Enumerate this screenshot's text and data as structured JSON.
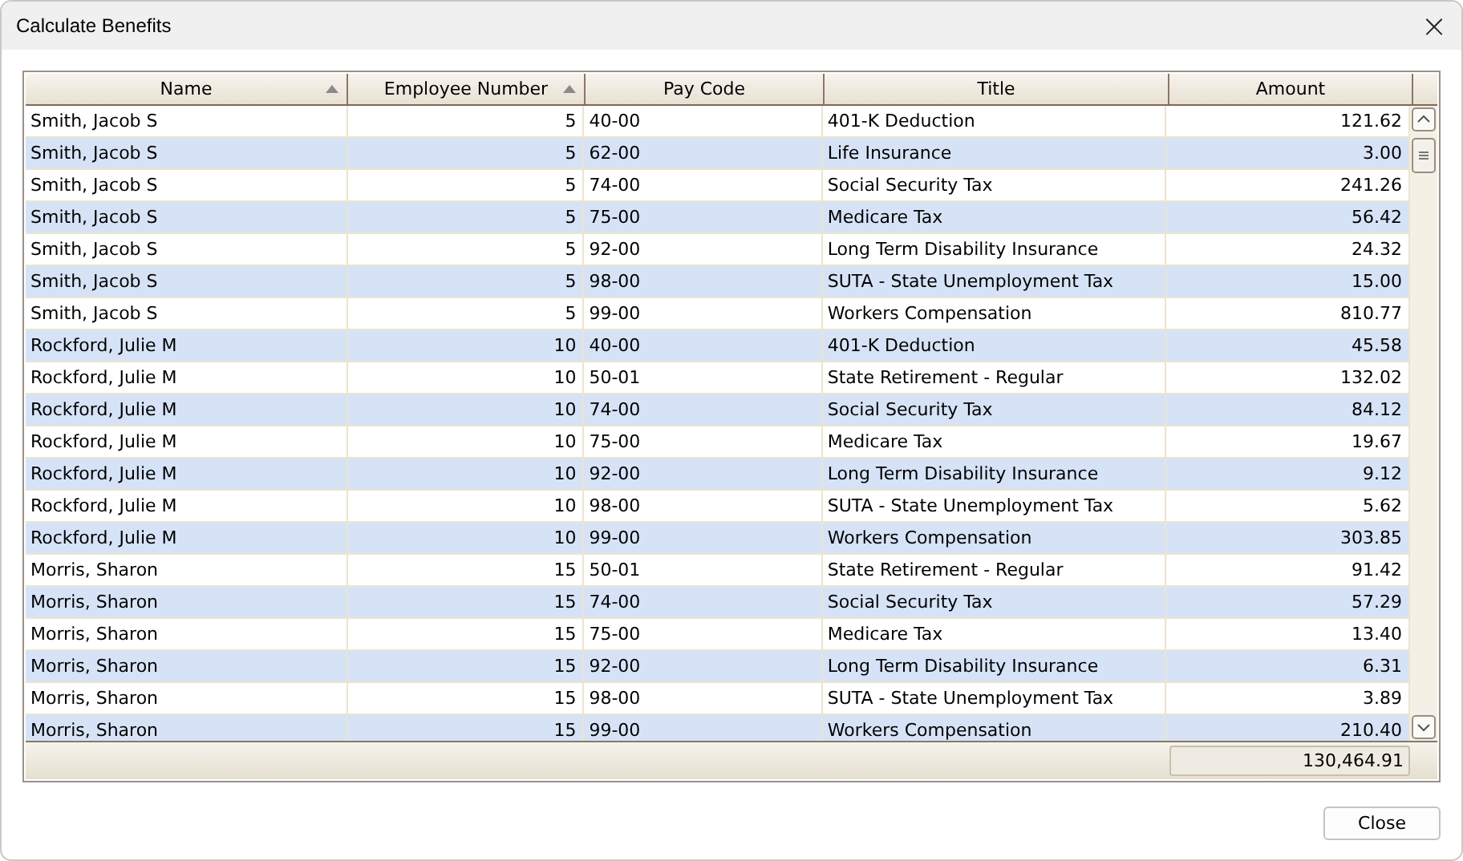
{
  "window": {
    "title": "Calculate Benefits",
    "close": "×"
  },
  "table": {
    "columns": [
      {
        "label": "Name",
        "sorted": true
      },
      {
        "label": "Employee Number",
        "sorted": true
      },
      {
        "label": "Pay Code",
        "sorted": false
      },
      {
        "label": "Title",
        "sorted": false
      },
      {
        "label": "Amount",
        "sorted": false
      }
    ],
    "rows": [
      [
        "Smith, Jacob S",
        "5",
        "40-00",
        "401-K Deduction",
        "121.62"
      ],
      [
        "Smith, Jacob S",
        "5",
        "62-00",
        "Life Insurance",
        "3.00"
      ],
      [
        "Smith, Jacob S",
        "5",
        "74-00",
        "Social Security Tax",
        "241.26"
      ],
      [
        "Smith, Jacob S",
        "5",
        "75-00",
        "Medicare Tax",
        "56.42"
      ],
      [
        "Smith, Jacob S",
        "5",
        "92-00",
        "Long Term Disability Insurance",
        "24.32"
      ],
      [
        "Smith, Jacob S",
        "5",
        "98-00",
        "SUTA - State Unemployment Tax",
        "15.00"
      ],
      [
        "Smith, Jacob S",
        "5",
        "99-00",
        "Workers Compensation",
        "810.77"
      ],
      [
        "Rockford, Julie M",
        "10",
        "40-00",
        "401-K Deduction",
        "45.58"
      ],
      [
        "Rockford, Julie M",
        "10",
        "50-01",
        "State Retirement - Regular",
        "132.02"
      ],
      [
        "Rockford, Julie M",
        "10",
        "74-00",
        "Social Security Tax",
        "84.12"
      ],
      [
        "Rockford, Julie M",
        "10",
        "75-00",
        "Medicare Tax",
        "19.67"
      ],
      [
        "Rockford, Julie M",
        "10",
        "92-00",
        "Long Term Disability Insurance",
        "9.12"
      ],
      [
        "Rockford, Julie M",
        "10",
        "98-00",
        "SUTA - State Unemployment Tax",
        "5.62"
      ],
      [
        "Rockford, Julie M",
        "10",
        "99-00",
        "Workers Compensation",
        "303.85"
      ],
      [
        "Morris, Sharon",
        "15",
        "50-01",
        "State Retirement - Regular",
        "91.42"
      ],
      [
        "Morris, Sharon",
        "15",
        "74-00",
        "Social Security Tax",
        "57.29"
      ],
      [
        "Morris, Sharon",
        "15",
        "75-00",
        "Medicare Tax",
        "13.40"
      ],
      [
        "Morris, Sharon",
        "15",
        "92-00",
        "Long Term Disability Insurance",
        "6.31"
      ],
      [
        "Morris, Sharon",
        "15",
        "98-00",
        "SUTA - State Unemployment Tax",
        "3.89"
      ],
      [
        "Morris, Sharon",
        "15",
        "99-00",
        "Workers Compensation",
        "210.40"
      ]
    ],
    "total": "130,464.91"
  },
  "buttons": [
    "Close"
  ]
}
